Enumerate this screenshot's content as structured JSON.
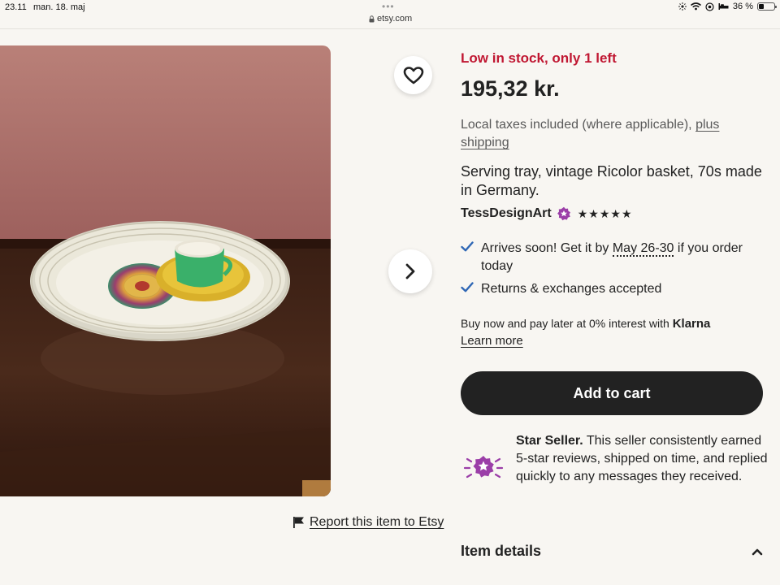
{
  "status_bar": {
    "time": "23.11",
    "date": "man. 18. maj",
    "url": "etsy.com",
    "battery": "36 %",
    "battery_level": 0.36
  },
  "listing": {
    "stock_notice": "Low in stock, only 1 left",
    "price": "195,32 kr.",
    "taxes_text": "Local taxes included (where applicable),",
    "shipping_link": "plus shipping",
    "title": "Serving tray, vintage Ricolor basket, 70s made in Germany.",
    "seller_name": "TessDesignArt",
    "rating_stars": "★★★★★",
    "rating": 5
  },
  "features": {
    "arrival_prefix": "Arrives soon! Get it by",
    "arrival_dates": "May 26-30",
    "arrival_suffix": "if you order today",
    "returns": "Returns & exchanges accepted"
  },
  "klarna": {
    "text": "Buy now and pay later at 0% interest with",
    "brand": "Klarna",
    "learn_more": "Learn more"
  },
  "cart": {
    "add_to_cart": "Add to cart"
  },
  "star_seller": {
    "label": "Star Seller.",
    "description": "This seller consistently earned 5-star reviews, shipped on time, and replied quickly to any messages they received."
  },
  "report": {
    "label": "Report this item to Etsy"
  },
  "item_details": {
    "title": "Item details"
  },
  "colors": {
    "stock_red": "#c01732",
    "button_dark": "#222222",
    "check_blue": "#2f67b5",
    "star_seller_purple": "#9b3ea8",
    "background": "#f8f6f2"
  }
}
